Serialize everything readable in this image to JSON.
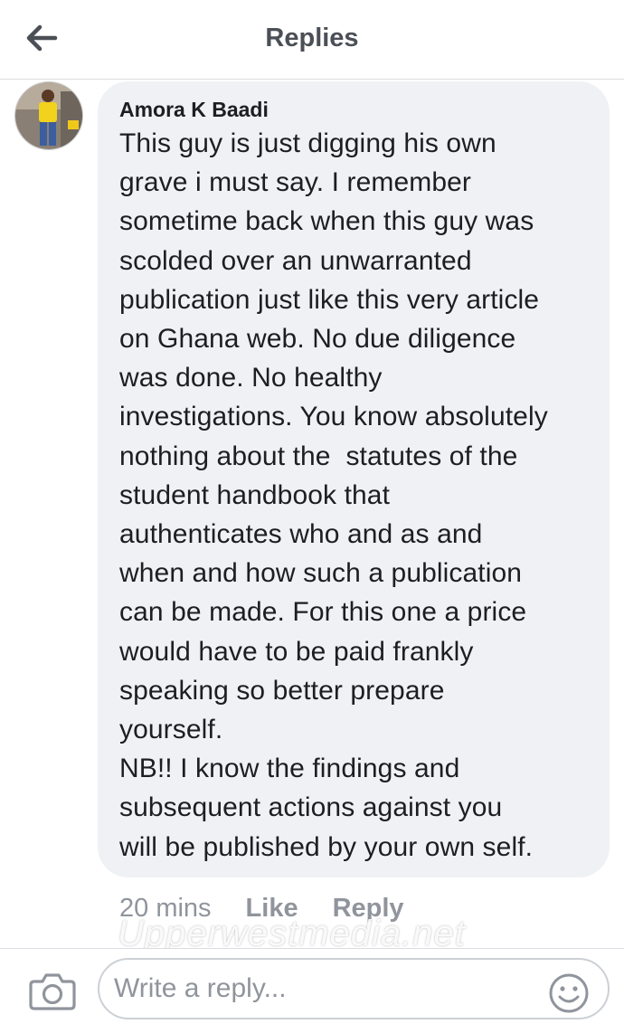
{
  "header": {
    "title": "Replies",
    "back_icon": "back-arrow-icon"
  },
  "comment": {
    "author": "Amora K Baadi",
    "body": "This guy is just digging his own\ngrave i must say. I remember\nsometime back when this guy was\nscolded over an unwarranted\npublication just like this very article\non Ghana web. No due diligence\nwas done. No healthy\ninvestigations. You know absolutely\nnothing about the  statutes of the\nstudent handbook that\nauthenticates who and as and\nwhen and how such a publication\ncan be made. For this one a price\nwould have to be paid frankly\nspeaking so better prepare\nyourself.\nNB!! I know the findings and\nsubsequent actions against you\nwill be published by your own self.",
    "time": "20 mins",
    "like_label": "Like",
    "reply_label": "Reply"
  },
  "watermark": "Upperwestmedia.net",
  "composer": {
    "placeholder": "Write a reply...",
    "camera_icon": "camera-icon",
    "emoji_icon": "emoji-icon"
  },
  "colors": {
    "bubble": "#f0f1f4",
    "muted_text": "#90949c",
    "header_text": "#4b4f56"
  }
}
